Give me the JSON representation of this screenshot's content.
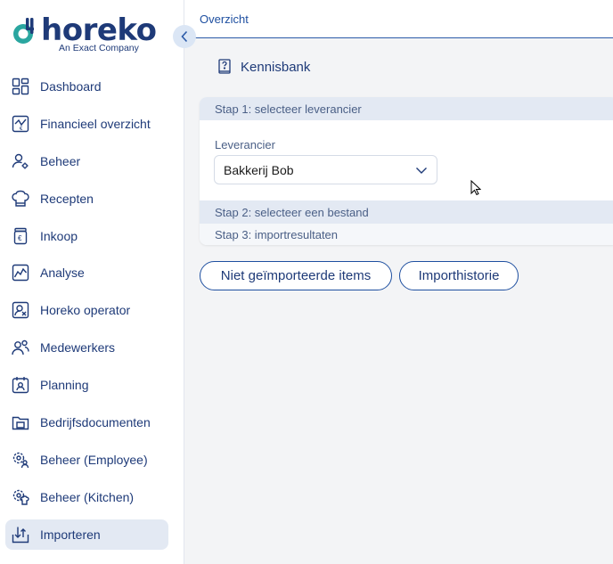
{
  "brand": {
    "name": "horeko",
    "tagline": "An Exact Company",
    "color": "#1e3a78",
    "accent": "#2aa6a0"
  },
  "sidebar": {
    "items": [
      {
        "label": "Dashboard",
        "icon": "dashboard-icon"
      },
      {
        "label": "Financieel overzicht",
        "icon": "finance-chart-icon"
      },
      {
        "label": "Beheer",
        "icon": "user-settings-icon"
      },
      {
        "label": "Recepten",
        "icon": "chef-hat-icon"
      },
      {
        "label": "Inkoop",
        "icon": "euro-jar-icon"
      },
      {
        "label": "Analyse",
        "icon": "analytics-chart-icon"
      },
      {
        "label": "Horeko operator",
        "icon": "operator-icon"
      },
      {
        "label": "Medewerkers",
        "icon": "employees-icon"
      },
      {
        "label": "Planning",
        "icon": "calendar-person-icon"
      },
      {
        "label": "Bedrijfsdocumenten",
        "icon": "folder-icon"
      },
      {
        "label": "Beheer (Employee)",
        "icon": "gear-person-icon"
      },
      {
        "label": "Beheer (Kitchen)",
        "icon": "gear-kitchen-icon"
      },
      {
        "label": "Importeren",
        "icon": "import-icon",
        "active": true
      }
    ]
  },
  "header": {
    "title": "Overzicht"
  },
  "main": {
    "knowledge_base": "Kennisbank",
    "steps": {
      "step1": "Stap 1: selecteer leverancier",
      "step2": "Stap 2: selecteer een bestand",
      "step3": "Stap 3: importresultaten"
    },
    "supplier_field": {
      "label": "Leverancier",
      "value": "Bakkerij Bob"
    },
    "buttons": {
      "not_imported": "Niet geïmporteerde items",
      "history": "Importhistorie"
    }
  }
}
